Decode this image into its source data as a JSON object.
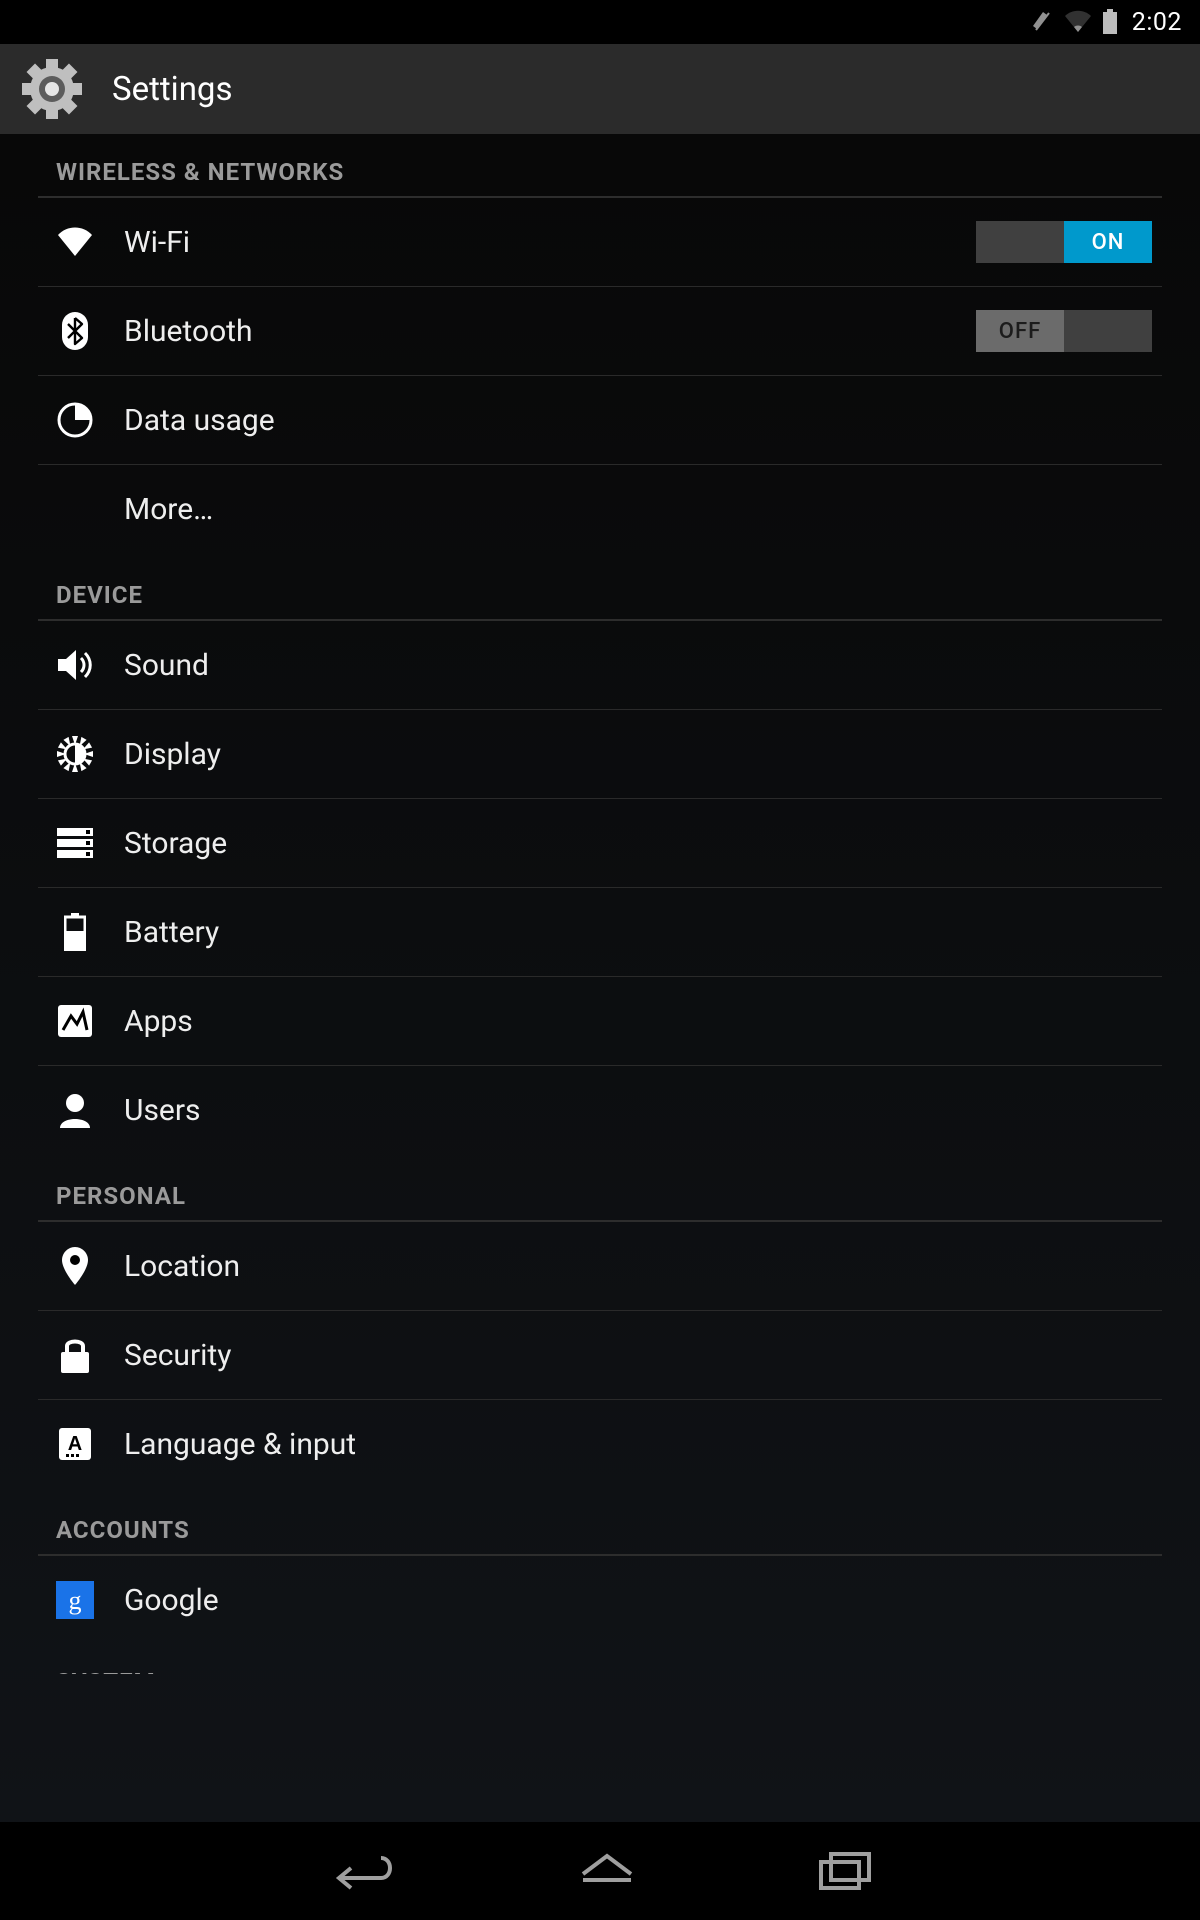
{
  "status_bar": {
    "time": "2:02",
    "vibrate_icon": "vibrate",
    "wifi_icon": "wifi-weak",
    "battery_icon": "battery"
  },
  "header": {
    "title": "Settings",
    "icon": "gear"
  },
  "sections": {
    "wireless": {
      "title": "WIRELESS & NETWORKS",
      "items": {
        "wifi": {
          "label": "Wi-Fi",
          "toggle_state": "ON"
        },
        "bluetooth": {
          "label": "Bluetooth",
          "toggle_state": "OFF"
        },
        "data": {
          "label": "Data usage"
        },
        "more": {
          "label": "More…"
        }
      }
    },
    "device": {
      "title": "DEVICE",
      "items": {
        "sound": {
          "label": "Sound"
        },
        "display": {
          "label": "Display"
        },
        "storage": {
          "label": "Storage"
        },
        "battery": {
          "label": "Battery"
        },
        "apps": {
          "label": "Apps"
        },
        "users": {
          "label": "Users"
        }
      }
    },
    "personal": {
      "title": "PERSONAL",
      "items": {
        "location": {
          "label": "Location"
        },
        "security": {
          "label": "Security"
        },
        "language": {
          "label": "Language & input"
        }
      }
    },
    "accounts": {
      "title": "ACCOUNTS",
      "items": {
        "google": {
          "label": "Google"
        }
      }
    },
    "system": {
      "title": "SYSTEM"
    }
  },
  "colors": {
    "accent_on": "#0099cc",
    "google_blue": "#1a73e8"
  }
}
